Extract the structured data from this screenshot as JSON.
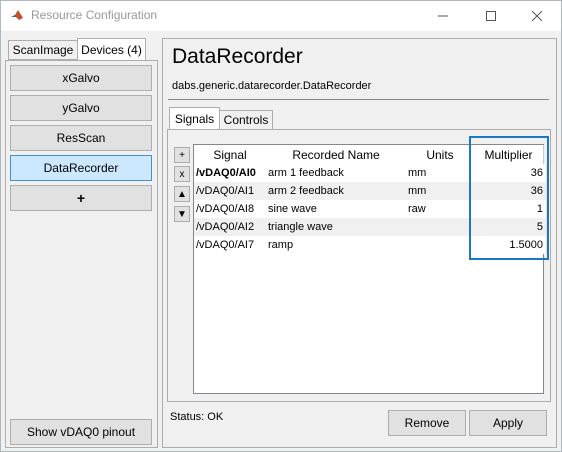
{
  "window": {
    "title": "Resource Configuration"
  },
  "left_tabs": [
    {
      "label": "ScanImage",
      "active": false
    },
    {
      "label": "Devices (4)",
      "active": true
    }
  ],
  "devices": [
    {
      "label": "xGalvo",
      "selected": false
    },
    {
      "label": "yGalvo",
      "selected": false
    },
    {
      "label": "ResScan",
      "selected": false
    },
    {
      "label": "DataRecorder",
      "selected": true
    }
  ],
  "add_device_label": "+",
  "pinout_button": "Show vDAQ0 pinout",
  "main": {
    "heading": "DataRecorder",
    "classname": "dabs.generic.datarecorder.DataRecorder",
    "tabs": [
      {
        "label": "Signals",
        "active": true
      },
      {
        "label": "Controls",
        "active": false
      }
    ],
    "side_buttons": {
      "add": "+",
      "remove": "x",
      "up": "▲",
      "down": "▼"
    },
    "table": {
      "columns": [
        "Signal",
        "Recorded Name",
        "Units",
        "Multiplier"
      ],
      "rows": [
        {
          "signal": "/vDAQ0/AI0",
          "name": "arm 1 feedback",
          "units": "mm",
          "multiplier": "36"
        },
        {
          "signal": "/vDAQ0/AI1",
          "name": "arm 2 feedback",
          "units": "mm",
          "multiplier": "36"
        },
        {
          "signal": "/vDAQ0/AI8",
          "name": "sine wave",
          "units": "raw",
          "multiplier": "1"
        },
        {
          "signal": "/vDAQ0/AI2",
          "name": "triangle wave",
          "units": "",
          "multiplier": "5"
        },
        {
          "signal": "/vDAQ0/AI7",
          "name": "ramp",
          "units": "",
          "multiplier": "1.5000"
        }
      ]
    },
    "status": "Status: OK",
    "remove_button": "Remove",
    "apply_button": "Apply"
  },
  "colors": {
    "selection": "#cce8ff",
    "highlight_box": "#1e78c1"
  }
}
